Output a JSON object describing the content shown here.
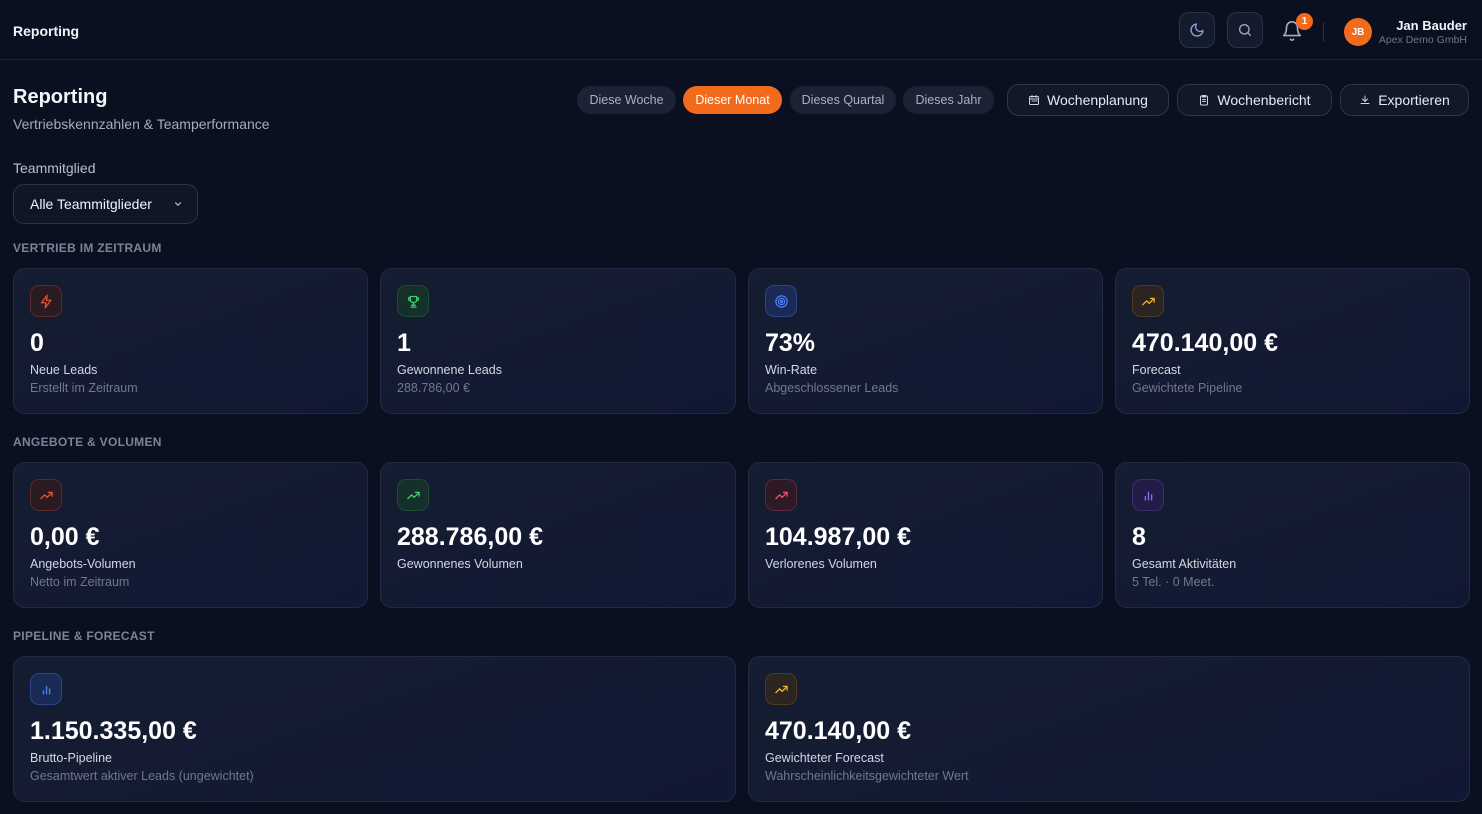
{
  "header": {
    "brand": "Reporting",
    "notification_count": "1",
    "user_initials": "JB",
    "user_name": "Jan Bauder",
    "user_org": "Apex Demo GmbH"
  },
  "page": {
    "title": "Reporting",
    "subtitle": "Vertriebskennzahlen & Teamperformance"
  },
  "periods": [
    {
      "label": "Diese Woche",
      "active": false
    },
    {
      "label": "Dieser Monat",
      "active": true
    },
    {
      "label": "Dieses Quartal",
      "active": false
    },
    {
      "label": "Dieses Jahr",
      "active": false
    }
  ],
  "actions": {
    "plan_label": "Wochenplanung",
    "report_label": "Wochenbericht",
    "export_label": "Exportieren"
  },
  "filter": {
    "label": "Teammitglied",
    "value": "Alle Teammitglieder"
  },
  "sections": {
    "sales": "VERTRIEB IM ZEITRAUM",
    "offers": "ANGEBOTE & VOLUMEN",
    "pipeline": "PIPELINE & FORECAST"
  },
  "sales_cards": [
    {
      "icon": "bolt-icon",
      "value": "0",
      "label": "Neue Leads",
      "sub": "Erstellt im Zeitraum"
    },
    {
      "icon": "trophy-icon",
      "value": "1",
      "label": "Gewonnene Leads",
      "sub": "288.786,00 €"
    },
    {
      "icon": "target-icon",
      "value": "73%",
      "label": "Win-Rate",
      "sub": "Abgeschlossener Leads"
    },
    {
      "icon": "trend-up-icon",
      "value": "470.140,00 €",
      "label": "Forecast",
      "sub": "Gewichtete Pipeline"
    }
  ],
  "offer_cards": [
    {
      "icon": "trend-up-icon",
      "value": "0,00 €",
      "label": "Angebots-Volumen",
      "sub": "Netto im Zeitraum"
    },
    {
      "icon": "trend-up-icon",
      "value": "288.786,00 €",
      "label": "Gewonnenes Volumen",
      "sub": ""
    },
    {
      "icon": "trend-up-icon",
      "value": "104.987,00 €",
      "label": "Verlorenes Volumen",
      "sub": ""
    },
    {
      "icon": "bar-chart-icon",
      "value": "8",
      "label": "Gesamt Aktivitäten",
      "sub": "5 Tel. · 0 Meet."
    }
  ],
  "pipeline_cards": [
    {
      "icon": "bar-chart-icon",
      "value": "1.150.335,00 €",
      "label": "Brutto-Pipeline",
      "sub": "Gesamtwert aktiver Leads (ungewichtet)"
    },
    {
      "icon": "trend-up-icon",
      "value": "470.140,00 €",
      "label": "Gewichteter Forecast",
      "sub": "Wahrscheinlichkeitsgewichteter Wert"
    }
  ],
  "colors": {
    "accent": "#f26b1d",
    "background": "#0b1020",
    "card": "#141c31",
    "red": "#e4572e",
    "green": "#3ecf6e",
    "blue": "#4f7ef7",
    "amber": "#f0b429",
    "rose": "#f0506e",
    "purple": "#8b6cf2"
  }
}
